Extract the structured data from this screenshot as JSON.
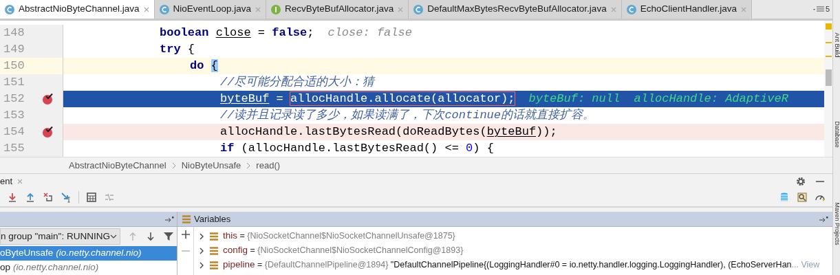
{
  "tabs": [
    {
      "label": "AbstractNioByteChannel.java",
      "kind": "class",
      "selected": true
    },
    {
      "label": "NioEventLoop.java",
      "kind": "class",
      "selected": false
    },
    {
      "label": "RecvByteBufAllocator.java",
      "kind": "interface",
      "selected": false
    },
    {
      "label": "DefaultMaxBytesRecvByteBufAllocator.java",
      "kind": "class",
      "selected": false
    },
    {
      "label": "EchoClientHandler.java",
      "kind": "class",
      "selected": false
    }
  ],
  "tabs_overflow": "5",
  "editor": {
    "lines": [
      {
        "number": "148",
        "breakpoint": false,
        "code": [
          {
            "kind": "keyword",
            "text": "boolean "
          },
          {
            "kind": "variable",
            "text": "close"
          },
          {
            "kind": "plain",
            "text": " = "
          },
          {
            "kind": "keyword",
            "text": "false"
          },
          {
            "kind": "plain",
            "text": ";"
          }
        ],
        "hint": "close: false"
      },
      {
        "number": "149",
        "breakpoint": false,
        "code": [
          {
            "kind": "keyword",
            "text": "try"
          },
          {
            "kind": "plain",
            "text": " {"
          }
        ],
        "children": [
          {
            "number": "150",
            "kind": "caret",
            "breakpoint": false,
            "code": [
              {
                "kind": "keyword",
                "text": "do "
              },
              {
                "kind": "brace",
                "text": "{"
              }
            ],
            "children": [
              {
                "number": "151",
                "breakpoint": false,
                "code": [
                  {
                    "kind": "comment",
                    "text": "//尽可能分配合适的大小：猜"
                  }
                ]
              },
              {
                "number": "152",
                "kind": "execution",
                "breakpoint": true,
                "code": [
                  {
                    "kind": "variable",
                    "text": "byteBuf"
                  },
                  {
                    "kind": "plain",
                    "text": " = "
                  },
                  {
                    "kind": "boxed",
                    "text": "allocHandle.allocate(allocator);"
                  }
                ],
                "hint": "byteBuf: null  allocHandle: AdaptiveR"
              },
              {
                "number": "153",
                "breakpoint": false,
                "code": [
                  {
                    "kind": "comment",
                    "text": "//读并且记录读了多少，如果读满了，下次continue的话就直接扩容。"
                  }
                ]
              },
              {
                "number": "154",
                "kind": "breakpoint",
                "breakpoint": true,
                "code": [
                  {
                    "kind": "plain",
                    "text": "allocHandle.lastBytesRead(doReadBytes("
                  },
                  {
                    "kind": "variable",
                    "text": "byteBuf"
                  },
                  {
                    "kind": "plain",
                    "text": "));"
                  }
                ]
              },
              {
                "number": "155",
                "breakpoint": false,
                "code": [
                  {
                    "kind": "keyword",
                    "text": "if"
                  },
                  {
                    "kind": "plain",
                    "text": " (allocHandle.lastBytesRead() <= "
                  },
                  {
                    "kind": "number",
                    "text": "0"
                  },
                  {
                    "kind": "plain",
                    "text": ") {"
                  }
                ]
              }
            ]
          }
        ]
      }
    ]
  },
  "breadcrumb": [
    "AbstractNioByteChannel",
    "NioByteUnsafe",
    "read()"
  ],
  "side_tabs": [
    "Ant Build",
    "Database",
    "Maven Projects"
  ],
  "debug": {
    "title": "ent",
    "frames_panel": {
      "thread": "n group \"main\": RUNNING",
      "frames": [
        {
          "method": "oByteUnsafe",
          "package": "(io.netty.channel.nio)",
          "selected": true
        },
        {
          "method": "op",
          "package": "(io.netty.channel.nio)",
          "selected": false
        }
      ]
    },
    "variables_panel": {
      "title": "Variables",
      "rows": [
        {
          "name": "this",
          "operator": "=",
          "value": "{NioSocketChannel$NioSocketChannelUnsafe@1875}",
          "expanded": false
        },
        {
          "name": "config",
          "operator": "=",
          "value": "{NioSocketChannel$NioSocketChannelConfig@1893}",
          "expanded": false
        },
        {
          "name": "pipeline",
          "operator": "=",
          "value": "{DefaultChannelPipeline@1894}",
          "text": "\"DefaultChannelPipeline{(LoggingHandler#0 = io.netty.handler.logging.LoggingHandler), (EchoServerHan",
          "link": "... View",
          "expanded": false
        }
      ]
    }
  }
}
